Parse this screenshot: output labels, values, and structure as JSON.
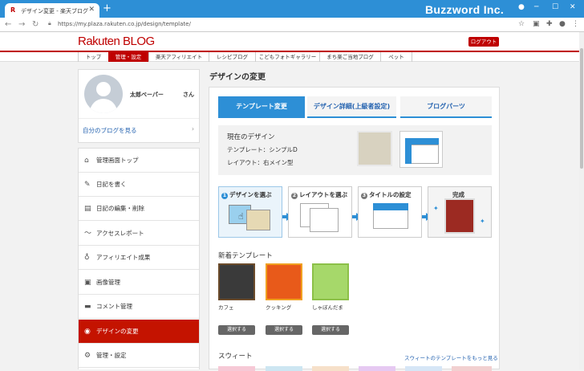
{
  "browser": {
    "tab_title": "デザイン変更 - 楽天ブログ",
    "tab_icon": "rakuten-r-icon",
    "url": "https://my.plaza.rakuten.co.jp/design/template/",
    "watermark": "Buzzword Inc."
  },
  "site": {
    "logo_main": "Rakuten",
    "logo_sub": "BLOG",
    "logout_label": "ログアウト",
    "menu": [
      "トップ",
      "管理・設定",
      "楽天アフィリエイト",
      "レシピブログ",
      "こどもフォトギャラリー",
      "まち楽ご当地ブログ",
      "ペット"
    ],
    "accent_color": "#bf0000"
  },
  "profile": {
    "name": "太郎ベーパー",
    "honorific": "さん",
    "link": "自分のブログを見る"
  },
  "sidebar": {
    "items": [
      {
        "label": "管理画面トップ",
        "icon": "home-icon"
      },
      {
        "label": "日記を書く",
        "icon": "pencil-icon"
      },
      {
        "label": "日記の編集・削除",
        "icon": "document-icon"
      },
      {
        "label": "アクセスレポート",
        "icon": "chart-line-icon"
      },
      {
        "label": "アフィリエイト成果",
        "icon": "moneybag-icon"
      },
      {
        "label": "画像管理",
        "icon": "image-icon"
      },
      {
        "label": "コメント管理",
        "icon": "comment-icon"
      },
      {
        "label": "デザインの変更",
        "icon": "palette-icon"
      },
      {
        "label": "管理・設定",
        "icon": "gear-icon"
      }
    ]
  },
  "main": {
    "title": "デザインの変更",
    "tabs": [
      "テンプレート変更",
      "デザイン詳細(上級者設定)",
      "ブログパーツ"
    ],
    "current": {
      "heading": "現在のデザイン",
      "template": "テンプレート：シンプルD",
      "layout": "レイアウト：右メイン型"
    },
    "steps": [
      {
        "num": "1",
        "label": "デザインを選ぶ"
      },
      {
        "num": "2",
        "label": "レイアウトを選ぶ"
      },
      {
        "num": "3",
        "label": "タイトルの設定"
      },
      {
        "num": "",
        "label": "完成"
      }
    ],
    "new_templates_heading": "新着テンプレート",
    "templates": [
      {
        "caption": "カフェ",
        "button": "選択する"
      },
      {
        "caption": "クッキング",
        "button": "選択する"
      },
      {
        "caption": "しゃぼんだま",
        "button": "選択する"
      }
    ],
    "sweets_heading": "スウィート",
    "sweets_more": "スウィートのテンプレートをもっと見る"
  }
}
